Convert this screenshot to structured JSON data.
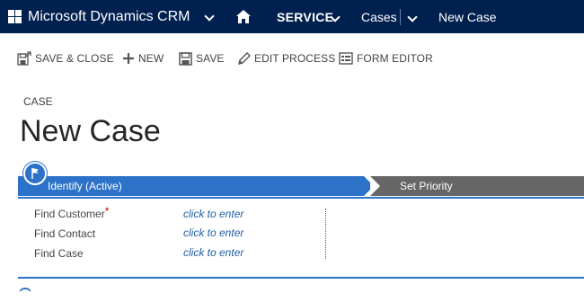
{
  "navbar": {
    "app_title": "Microsoft Dynamics CRM",
    "area": "SERVICE",
    "entity": "Cases",
    "record": "New Case",
    "background_color": "#002050"
  },
  "commands": [
    {
      "label": "SAVE & CLOSE",
      "icon": "save-close-icon"
    },
    {
      "label": "NEW",
      "icon": "plus-icon"
    },
    {
      "label": "SAVE",
      "icon": "save-icon"
    },
    {
      "label": "EDIT PROCESS",
      "icon": "pencil-icon"
    },
    {
      "label": "FORM EDITOR",
      "icon": "form-editor-icon"
    }
  ],
  "header": {
    "entity_type": "CASE",
    "title": "New Case"
  },
  "process": {
    "stages": [
      {
        "label": "Identify (Active)",
        "active": true
      },
      {
        "label": "Set Priority",
        "active": false
      }
    ],
    "active_color": "#2b72c8",
    "inactive_color": "#666666"
  },
  "fields": [
    {
      "label": "Find Customer",
      "required": "*",
      "value": "click to enter"
    },
    {
      "label": "Find Contact",
      "value": "click to enter"
    },
    {
      "label": "Find Case",
      "value": "click to enter"
    }
  ]
}
